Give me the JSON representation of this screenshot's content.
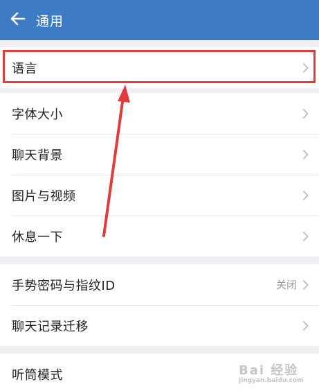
{
  "colors": {
    "header": "#3e7bc5",
    "annotation": "#e23b3b"
  },
  "header": {
    "title": "通用",
    "back_icon": "arrow-left-icon"
  },
  "groups": [
    {
      "items": [
        {
          "label": "语言"
        }
      ]
    },
    {
      "items": [
        {
          "label": "字体大小"
        },
        {
          "label": "聊天背景"
        },
        {
          "label": "图片与视频"
        },
        {
          "label": "休息一下"
        }
      ]
    },
    {
      "items": [
        {
          "label": "手势密码与指纹ID",
          "value": "关闭"
        },
        {
          "label": "聊天记录迁移"
        }
      ]
    },
    {
      "items": [
        {
          "label": "听筒模式"
        }
      ]
    }
  ],
  "watermark": {
    "text": "Bai 经验",
    "sub": "jingyan.baidu.com"
  }
}
